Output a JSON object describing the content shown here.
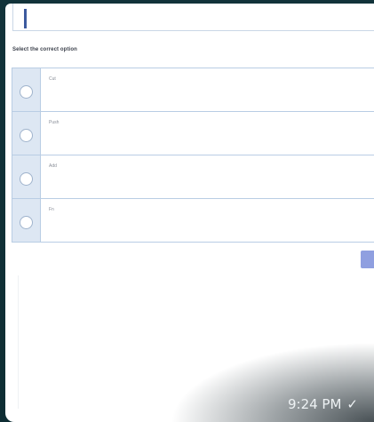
{
  "question": {
    "prompt": "Select the correct option",
    "options": [
      {
        "label": "Cut"
      },
      {
        "label": "Push"
      },
      {
        "label": "Add"
      },
      {
        "label": "Fn"
      }
    ]
  },
  "message": {
    "time": "9:24 PM",
    "status_icon": "check-icon",
    "status_glyph": "✓"
  }
}
